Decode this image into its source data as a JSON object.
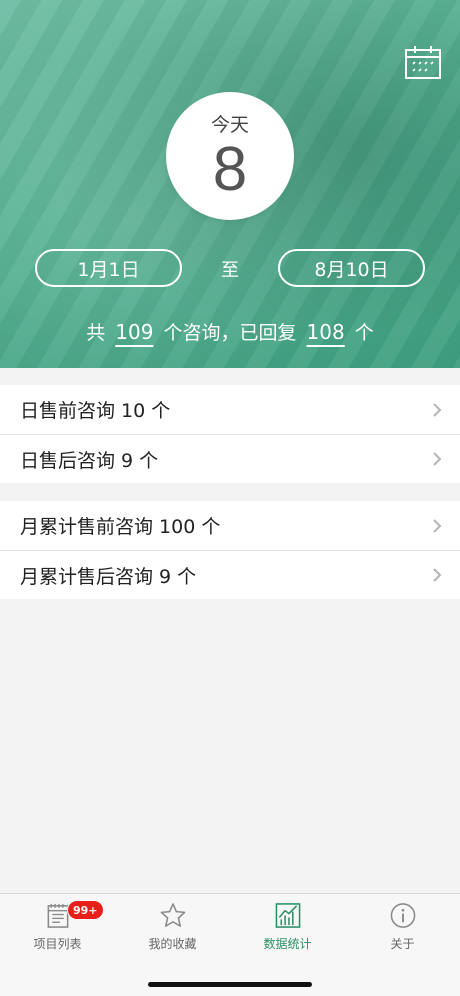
{
  "header": {
    "today_label": "今天",
    "today_count": "8",
    "date_from": "1月1日",
    "date_separator": "至",
    "date_to": "8月10日",
    "summary": {
      "prefix": "共",
      "total": "109",
      "middle": "个咨询，已回复",
      "replied": "108",
      "suffix": "个"
    }
  },
  "daily_list": [
    {
      "label": "日售前咨询 10 个"
    },
    {
      "label": "日售后咨询 9 个"
    }
  ],
  "monthly_list": [
    {
      "label": "月累计售前咨询 100 个"
    },
    {
      "label": "月累计售后咨询 9 个"
    }
  ],
  "tabbar": {
    "items": [
      {
        "label": "项目列表",
        "icon": "list-icon",
        "badge": "99+"
      },
      {
        "label": "我的收藏",
        "icon": "star-icon"
      },
      {
        "label": "数据统计",
        "icon": "chart-icon",
        "active": true
      },
      {
        "label": "关于",
        "icon": "info-icon"
      }
    ]
  },
  "colors": {
    "accent": "#2d8f66",
    "header_green": "#54b091",
    "badge_red": "#e8201a"
  }
}
